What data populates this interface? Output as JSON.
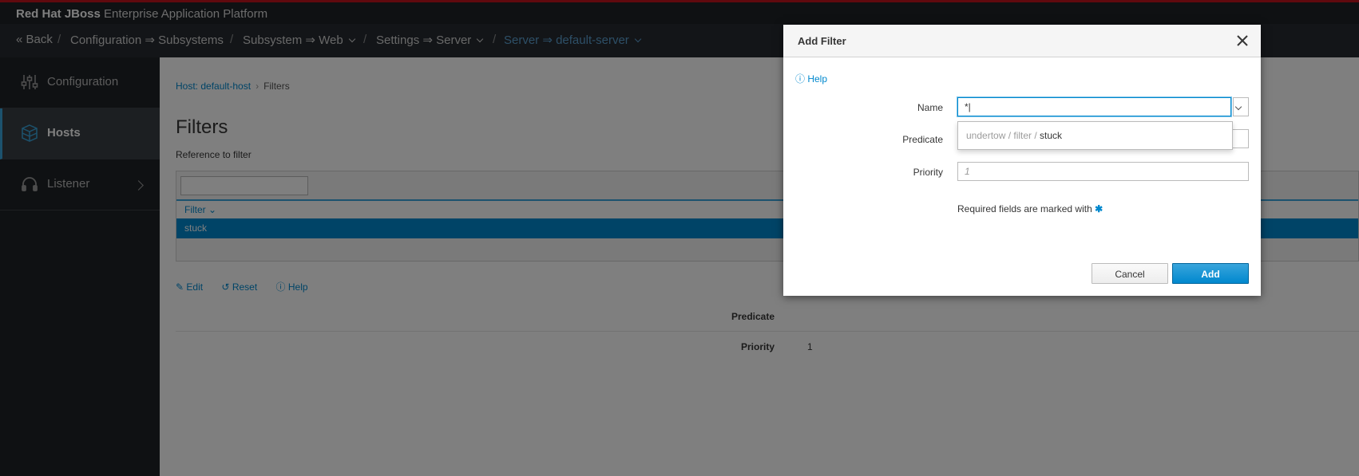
{
  "brand": {
    "bold": "Red Hat JBoss",
    "rest": " Enterprise Application Platform"
  },
  "nav": {
    "back": "« Back",
    "sep": "/",
    "configuration": "Configuration ⇒ Subsystems",
    "subsystem": "Subsystem ⇒ Web",
    "settings": "Settings ⇒ Server",
    "server": "Server ⇒ default-server"
  },
  "sidebar": {
    "items": [
      {
        "label": "Configuration",
        "icon": "sliders-icon"
      },
      {
        "label": "Hosts",
        "icon": "cubes-icon"
      },
      {
        "label": "Listener",
        "icon": "headset-icon"
      }
    ]
  },
  "main": {
    "breadcrumb_link": "Host: default-host",
    "breadcrumb_sep": "›",
    "breadcrumb_current": "Filters",
    "title": "Filters",
    "description": "Reference to filter",
    "table": {
      "header": "Filter ⌄",
      "rows": [
        "stuck"
      ]
    },
    "actions": {
      "edit": "Edit",
      "reset": "Reset",
      "help": "Help"
    },
    "attributes": {
      "predicate_label": "Predicate",
      "priority_label": "Priority",
      "priority_value": "1"
    }
  },
  "dialog": {
    "title": "Add Filter",
    "help": "Help",
    "fields": {
      "name_label": "Name",
      "name_value": "*|",
      "predicate_label": "Predicate",
      "priority_label": "Priority",
      "priority_placeholder": "1"
    },
    "typeahead": {
      "path": "undertow / filter / ",
      "match": "stuck"
    },
    "required_note": "Required fields are marked with",
    "required_star": "✱",
    "cancel": "Cancel",
    "add": "Add"
  }
}
